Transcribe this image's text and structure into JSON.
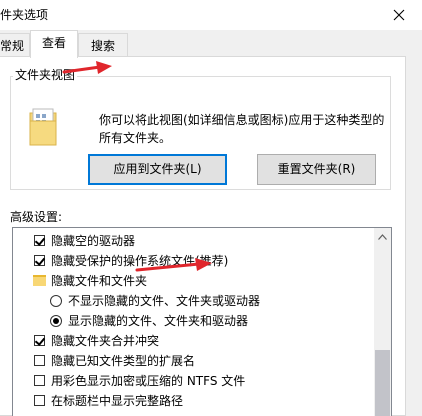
{
  "window": {
    "title": "件夹选项"
  },
  "tabs": [
    {
      "label": "常规",
      "active": false
    },
    {
      "label": "查看",
      "active": true
    },
    {
      "label": "搜索",
      "active": false
    }
  ],
  "folder_views": {
    "legend": "文件夹视图",
    "description": "你可以将此视图(如详细信息或图标)应用于这种类型的所有文件夹。",
    "apply_button": "应用到文件夹(L)",
    "reset_button": "重置文件夹(R)"
  },
  "advanced": {
    "label": "高级设置:",
    "items": [
      {
        "type": "checkbox",
        "checked": true,
        "label": "隐藏空的驱动器"
      },
      {
        "type": "checkbox",
        "checked": true,
        "label": "隐藏受保护的操作系统文件(推荐)"
      },
      {
        "type": "folder",
        "label": "隐藏文件和文件夹"
      },
      {
        "type": "radio",
        "checked": false,
        "label": "不显示隐藏的文件、文件夹或驱动器"
      },
      {
        "type": "radio",
        "checked": true,
        "label": "显示隐藏的文件、文件夹和驱动器"
      },
      {
        "type": "checkbox",
        "checked": true,
        "label": "隐藏文件夹合并冲突"
      },
      {
        "type": "checkbox",
        "checked": false,
        "label": "隐藏已知文件类型的扩展名"
      },
      {
        "type": "checkbox",
        "checked": false,
        "label": "用彩色显示加密或压缩的 NTFS 文件"
      },
      {
        "type": "checkbox",
        "checked": false,
        "label": "在标题栏中显示完整路径"
      }
    ]
  },
  "annotation_color": "#e0262c"
}
